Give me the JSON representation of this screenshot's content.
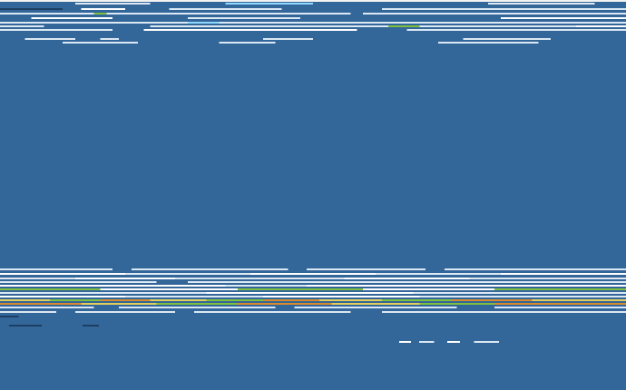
{
  "screen": {
    "background": "#336699",
    "status": ""
  },
  "colors": {
    "band_light": "#dce8f4",
    "band_white": "#ffffff",
    "band_cyan": "#8fd8ff",
    "band_green": "#7fbf3f",
    "band_orange": "#d98a2b",
    "band_yellow": "#e2cf5b",
    "band_dark": "#1e3f63"
  }
}
